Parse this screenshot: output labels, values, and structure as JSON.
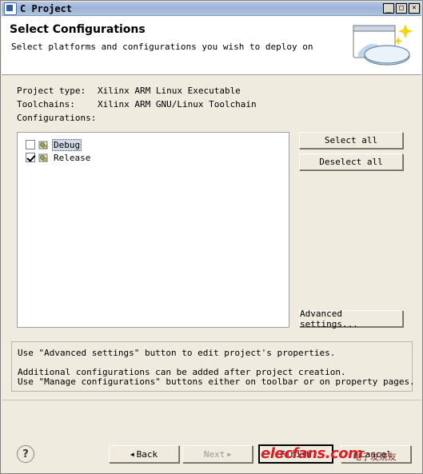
{
  "window": {
    "title": "C Project",
    "icon": "project-window-icon",
    "buttons": {
      "minimize": "_",
      "maximize": "□",
      "close": "✕"
    }
  },
  "header": {
    "title": "Select Configurations",
    "subtitle": "Select platforms and configurations you wish to deploy on",
    "art_icon": "wizard-banner-icon"
  },
  "info": {
    "rows": [
      {
        "label": "Project type:",
        "value": "Xilinx ARM Linux Executable"
      },
      {
        "label": "Toolchains:",
        "value": "Xilinx ARM GNU/Linux Toolchain"
      },
      {
        "label": "Configurations:",
        "value": ""
      }
    ]
  },
  "configurations": [
    {
      "name": "Debug",
      "checked": false,
      "selected": true
    },
    {
      "name": "Release",
      "checked": true,
      "selected": false
    }
  ],
  "buttons": {
    "select_all": "Select all",
    "deselect_all": "Deselect all",
    "advanced_settings": "Advanced settings..."
  },
  "note": {
    "lines": [
      "Use \"Advanced settings\" button to edit project's properties.",
      "",
      "Additional configurations can be added after project creation.",
      "Use \"Manage configurations\" buttons either on toolbar or on property pages."
    ]
  },
  "footer": {
    "help": "?",
    "back": "Back",
    "next": "Next",
    "finish": "Finish",
    "cancel": "Cancel",
    "back_arrow": "◀",
    "next_arrow": "▶"
  },
  "watermark": {
    "text": "elecfans.com",
    "sub": "电子发烧友"
  },
  "colors": {
    "dialog_bg": "#efebdf",
    "header_bg": "#ffffff",
    "titlebar": "#9db3d6",
    "watermark_red": "#d81f26"
  }
}
